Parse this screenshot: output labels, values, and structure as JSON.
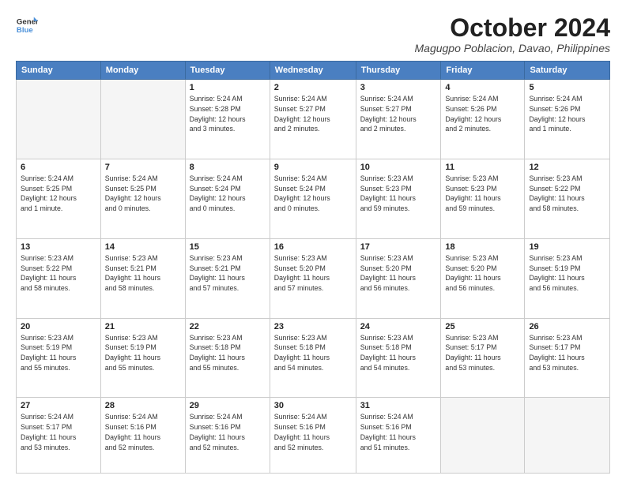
{
  "logo": {
    "line1": "General",
    "line2": "Blue"
  },
  "header": {
    "month": "October 2024",
    "location": "Magugpo Poblacion, Davao, Philippines"
  },
  "weekdays": [
    "Sunday",
    "Monday",
    "Tuesday",
    "Wednesday",
    "Thursday",
    "Friday",
    "Saturday"
  ],
  "weeks": [
    [
      {
        "day": "",
        "empty": true
      },
      {
        "day": "",
        "empty": true
      },
      {
        "day": "1",
        "detail": "Sunrise: 5:24 AM\nSunset: 5:28 PM\nDaylight: 12 hours\nand 3 minutes."
      },
      {
        "day": "2",
        "detail": "Sunrise: 5:24 AM\nSunset: 5:27 PM\nDaylight: 12 hours\nand 2 minutes."
      },
      {
        "day": "3",
        "detail": "Sunrise: 5:24 AM\nSunset: 5:27 PM\nDaylight: 12 hours\nand 2 minutes."
      },
      {
        "day": "4",
        "detail": "Sunrise: 5:24 AM\nSunset: 5:26 PM\nDaylight: 12 hours\nand 2 minutes."
      },
      {
        "day": "5",
        "detail": "Sunrise: 5:24 AM\nSunset: 5:26 PM\nDaylight: 12 hours\nand 1 minute."
      }
    ],
    [
      {
        "day": "6",
        "detail": "Sunrise: 5:24 AM\nSunset: 5:25 PM\nDaylight: 12 hours\nand 1 minute."
      },
      {
        "day": "7",
        "detail": "Sunrise: 5:24 AM\nSunset: 5:25 PM\nDaylight: 12 hours\nand 0 minutes."
      },
      {
        "day": "8",
        "detail": "Sunrise: 5:24 AM\nSunset: 5:24 PM\nDaylight: 12 hours\nand 0 minutes."
      },
      {
        "day": "9",
        "detail": "Sunrise: 5:24 AM\nSunset: 5:24 PM\nDaylight: 12 hours\nand 0 minutes."
      },
      {
        "day": "10",
        "detail": "Sunrise: 5:23 AM\nSunset: 5:23 PM\nDaylight: 11 hours\nand 59 minutes."
      },
      {
        "day": "11",
        "detail": "Sunrise: 5:23 AM\nSunset: 5:23 PM\nDaylight: 11 hours\nand 59 minutes."
      },
      {
        "day": "12",
        "detail": "Sunrise: 5:23 AM\nSunset: 5:22 PM\nDaylight: 11 hours\nand 58 minutes."
      }
    ],
    [
      {
        "day": "13",
        "detail": "Sunrise: 5:23 AM\nSunset: 5:22 PM\nDaylight: 11 hours\nand 58 minutes."
      },
      {
        "day": "14",
        "detail": "Sunrise: 5:23 AM\nSunset: 5:21 PM\nDaylight: 11 hours\nand 58 minutes."
      },
      {
        "day": "15",
        "detail": "Sunrise: 5:23 AM\nSunset: 5:21 PM\nDaylight: 11 hours\nand 57 minutes."
      },
      {
        "day": "16",
        "detail": "Sunrise: 5:23 AM\nSunset: 5:20 PM\nDaylight: 11 hours\nand 57 minutes."
      },
      {
        "day": "17",
        "detail": "Sunrise: 5:23 AM\nSunset: 5:20 PM\nDaylight: 11 hours\nand 56 minutes."
      },
      {
        "day": "18",
        "detail": "Sunrise: 5:23 AM\nSunset: 5:20 PM\nDaylight: 11 hours\nand 56 minutes."
      },
      {
        "day": "19",
        "detail": "Sunrise: 5:23 AM\nSunset: 5:19 PM\nDaylight: 11 hours\nand 56 minutes."
      }
    ],
    [
      {
        "day": "20",
        "detail": "Sunrise: 5:23 AM\nSunset: 5:19 PM\nDaylight: 11 hours\nand 55 minutes."
      },
      {
        "day": "21",
        "detail": "Sunrise: 5:23 AM\nSunset: 5:19 PM\nDaylight: 11 hours\nand 55 minutes."
      },
      {
        "day": "22",
        "detail": "Sunrise: 5:23 AM\nSunset: 5:18 PM\nDaylight: 11 hours\nand 55 minutes."
      },
      {
        "day": "23",
        "detail": "Sunrise: 5:23 AM\nSunset: 5:18 PM\nDaylight: 11 hours\nand 54 minutes."
      },
      {
        "day": "24",
        "detail": "Sunrise: 5:23 AM\nSunset: 5:18 PM\nDaylight: 11 hours\nand 54 minutes."
      },
      {
        "day": "25",
        "detail": "Sunrise: 5:23 AM\nSunset: 5:17 PM\nDaylight: 11 hours\nand 53 minutes."
      },
      {
        "day": "26",
        "detail": "Sunrise: 5:23 AM\nSunset: 5:17 PM\nDaylight: 11 hours\nand 53 minutes."
      }
    ],
    [
      {
        "day": "27",
        "detail": "Sunrise: 5:24 AM\nSunset: 5:17 PM\nDaylight: 11 hours\nand 53 minutes."
      },
      {
        "day": "28",
        "detail": "Sunrise: 5:24 AM\nSunset: 5:16 PM\nDaylight: 11 hours\nand 52 minutes."
      },
      {
        "day": "29",
        "detail": "Sunrise: 5:24 AM\nSunset: 5:16 PM\nDaylight: 11 hours\nand 52 minutes."
      },
      {
        "day": "30",
        "detail": "Sunrise: 5:24 AM\nSunset: 5:16 PM\nDaylight: 11 hours\nand 52 minutes."
      },
      {
        "day": "31",
        "detail": "Sunrise: 5:24 AM\nSunset: 5:16 PM\nDaylight: 11 hours\nand 51 minutes."
      },
      {
        "day": "",
        "empty": true
      },
      {
        "day": "",
        "empty": true
      }
    ]
  ]
}
